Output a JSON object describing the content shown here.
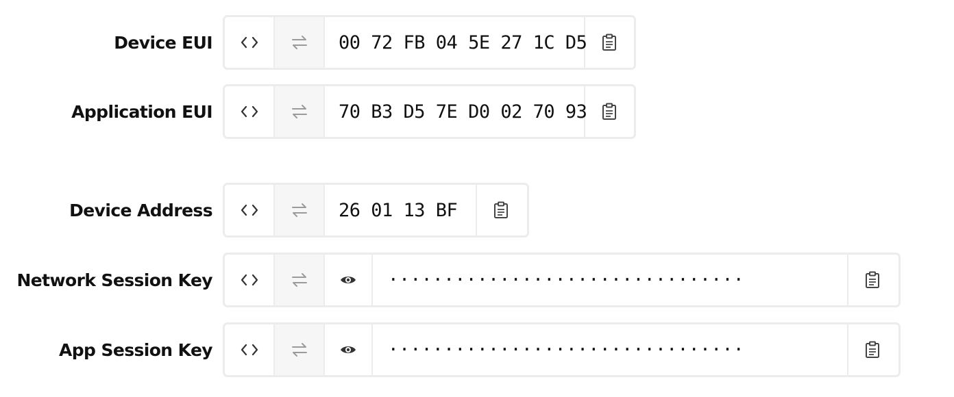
{
  "fields": [
    {
      "label": "Device EUI",
      "value": "00 72 FB 04 5E 27 1C D5"
    },
    {
      "label": "Application EUI",
      "value": "70 B3 D5 7E D0 02 70 93"
    },
    {
      "label": "Device Address",
      "value": "26 01 13 BF"
    },
    {
      "label": "Network Session Key",
      "value": "································"
    },
    {
      "label": "App Session Key",
      "value": "································"
    }
  ],
  "icons": {
    "format": "code-brackets-icon",
    "swap": "swap-arrows-icon",
    "reveal": "eye-icon",
    "copy": "clipboard-icon"
  }
}
